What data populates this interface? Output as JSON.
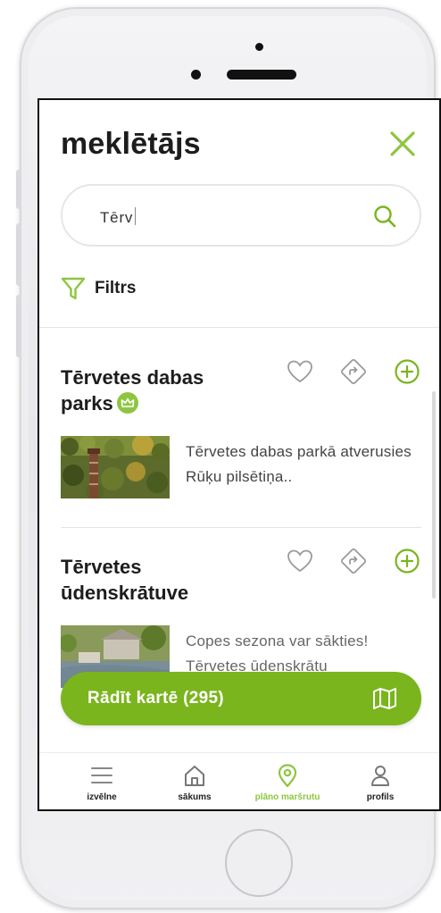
{
  "header": {
    "title": "meklētājs"
  },
  "search": {
    "value": "Tērv"
  },
  "filter": {
    "label": "Filtrs"
  },
  "results": [
    {
      "title": "Tērvetes dabas parks",
      "premium": true,
      "description": "Tērvetes dabas parkā atverusies Rūķu pilsētiņa.."
    },
    {
      "title": "Tērvetes ūdenskrātuve",
      "premium": false,
      "description": "Copes sezona var sākties! Tērvetes ūdenskrātu"
    }
  ],
  "map_button": {
    "label": "Rādīt kartē (295)"
  },
  "tabbar": {
    "items": [
      {
        "label": "izvēlne",
        "icon": "menu-icon",
        "active": false
      },
      {
        "label": "sākums",
        "icon": "home-icon",
        "active": false
      },
      {
        "label": "plāno maršrutu",
        "icon": "location-pin-icon",
        "active": true
      },
      {
        "label": "profils",
        "icon": "user-icon",
        "active": false
      }
    ]
  },
  "colors": {
    "accent": "#8cc63f",
    "button": "#7ab51d",
    "text": "#1d1d1d"
  }
}
